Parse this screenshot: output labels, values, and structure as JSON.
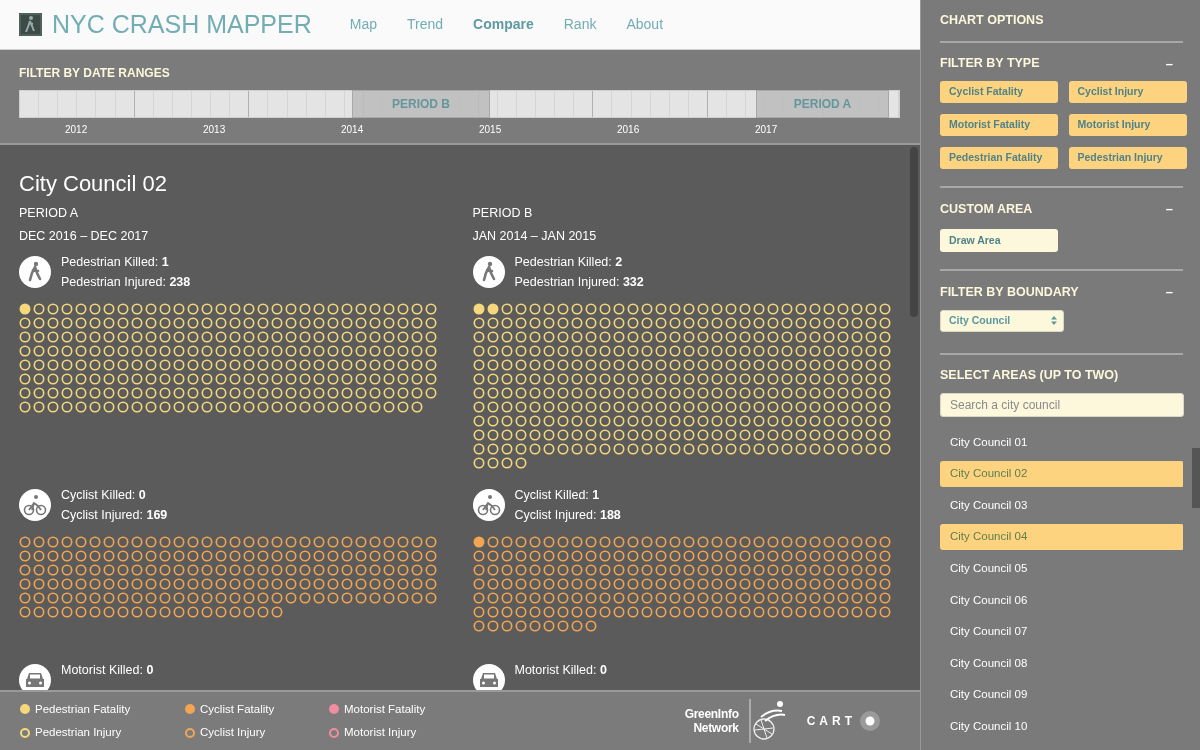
{
  "header": {
    "title": "NYC CRASH MAPPER",
    "nav": [
      {
        "label": "Map",
        "selected": false
      },
      {
        "label": "Trend",
        "selected": false
      },
      {
        "label": "Compare",
        "selected": true
      },
      {
        "label": "Rank",
        "selected": false
      },
      {
        "label": "About",
        "selected": false
      }
    ]
  },
  "date_filter": {
    "title": "FILTER BY DATE RANGES",
    "periods": [
      {
        "label": "PERIOD B"
      },
      {
        "label": "PERIOD A"
      }
    ],
    "years": [
      "2012",
      "2013",
      "2014",
      "2015",
      "2016",
      "2017"
    ]
  },
  "comparison": {
    "area": "City Council 02",
    "columns": [
      {
        "period": "PERIOD A",
        "range": "DEC 2016 – DEC 2017",
        "groups": [
          {
            "kind": "pedestrian",
            "color": "#f5d87c",
            "killed_label": "Pedestrian Killed:",
            "killed": "1",
            "injured_label": "Pedestrian Injured:",
            "injured": "238"
          },
          {
            "kind": "cyclist",
            "color": "#f2a552",
            "killed_label": "Cyclist Killed:",
            "killed": "0",
            "injured_label": "Cyclist Injured:",
            "injured": "169"
          },
          {
            "kind": "motorist",
            "killed_label": "Motorist Killed:",
            "killed": "0"
          }
        ]
      },
      {
        "period": "PERIOD B",
        "range": "JAN 2014 – JAN 2015",
        "groups": [
          {
            "kind": "pedestrian",
            "color": "#f5d87c",
            "killed_label": "Pedestrian Killed:",
            "killed": "2",
            "injured_label": "Pedestrian Injured:",
            "injured": "332"
          },
          {
            "kind": "cyclist",
            "color": "#f2a552",
            "killed_label": "Cyclist Killed:",
            "killed": "1",
            "injured_label": "Cyclist Injured:",
            "injured": "188"
          },
          {
            "kind": "motorist",
            "killed_label": "Motorist Killed:",
            "killed": "0"
          }
        ]
      }
    ]
  },
  "legend": [
    {
      "label": "Pedestrian Fatality",
      "color": "#f5d87c",
      "kind": "fatality"
    },
    {
      "label": "Pedestrian Injury",
      "color": "#f5d87c",
      "kind": "injury"
    },
    {
      "label": "Cyclist Fatality",
      "color": "#f2a552",
      "kind": "fatality"
    },
    {
      "label": "Cyclist Injury",
      "color": "#f2a552",
      "kind": "injury"
    },
    {
      "label": "Motorist Fatality",
      "color": "#f08da2",
      "kind": "fatality"
    },
    {
      "label": "Motorist Injury",
      "color": "#f08da2",
      "kind": "injury"
    }
  ],
  "credits": {
    "greeninfo": [
      "GreenInfo",
      "Network"
    ],
    "carto": "CART"
  },
  "sidebar": {
    "title": "CHART OPTIONS",
    "type_filter": {
      "title": "FILTER BY TYPE",
      "toggle": "–",
      "buttons": [
        {
          "label": "Cyclist Fatality",
          "selected": true
        },
        {
          "label": "Cyclist Injury",
          "selected": true
        },
        {
          "label": "Motorist Fatality",
          "selected": true
        },
        {
          "label": "Motorist Injury",
          "selected": true
        },
        {
          "label": "Pedestrian Fatality",
          "selected": true
        },
        {
          "label": "Pedestrian Injury",
          "selected": true
        }
      ]
    },
    "custom_area": {
      "title": "CUSTOM AREA",
      "toggle": "–",
      "button": "Draw Area"
    },
    "boundary": {
      "title": "FILTER BY BOUNDARY",
      "toggle": "–",
      "value": "City Council"
    },
    "areas": {
      "title": "SELECT AREAS (UP TO TWO)",
      "placeholder": "Search a city council",
      "items": [
        {
          "label": "City Council 01",
          "selected": false
        },
        {
          "label": "City Council 02",
          "selected": true
        },
        {
          "label": "City Council 03",
          "selected": false
        },
        {
          "label": "City Council 04",
          "selected": true
        },
        {
          "label": "City Council 05",
          "selected": false
        },
        {
          "label": "City Council 06",
          "selected": false
        },
        {
          "label": "City Council 07",
          "selected": false
        },
        {
          "label": "City Council 08",
          "selected": false
        },
        {
          "label": "City Council 09",
          "selected": false
        },
        {
          "label": "City Council 10",
          "selected": false
        }
      ]
    }
  }
}
